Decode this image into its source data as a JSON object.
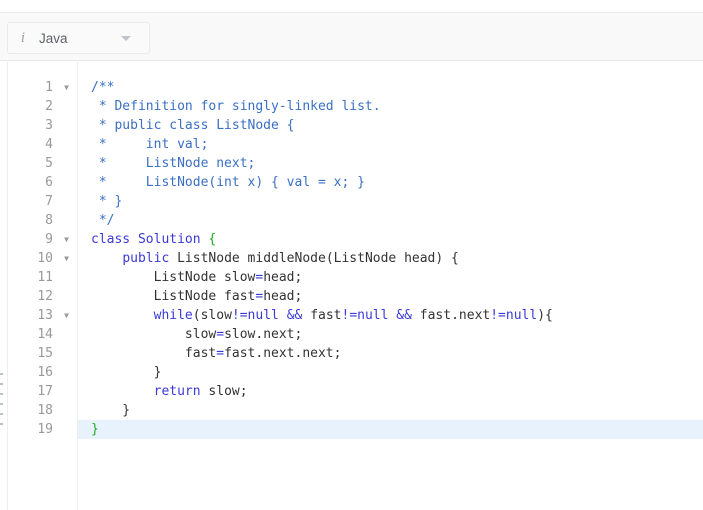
{
  "toolbar": {
    "language_icon": "info-italic-icon",
    "language_label": "Java",
    "language_caret_icon": "caret-down-icon"
  },
  "editor": {
    "active_line": 19,
    "colors": {
      "comment": "#3a6fc4",
      "keyword": "#3a3ad8",
      "brace_match": "#22aa22",
      "active_line_bg": "#e8f2fc"
    },
    "lines": [
      {
        "n": "1",
        "fold": true,
        "tokens": [
          {
            "t": "/**",
            "c": "comment"
          }
        ]
      },
      {
        "n": "2",
        "fold": false,
        "tokens": [
          {
            "t": " * Definition for singly-linked list.",
            "c": "comment"
          }
        ]
      },
      {
        "n": "3",
        "fold": false,
        "tokens": [
          {
            "t": " * public class ListNode {",
            "c": "comment"
          }
        ]
      },
      {
        "n": "4",
        "fold": false,
        "tokens": [
          {
            "t": " *     int val;",
            "c": "comment"
          }
        ]
      },
      {
        "n": "5",
        "fold": false,
        "tokens": [
          {
            "t": " *     ListNode next;",
            "c": "comment"
          }
        ]
      },
      {
        "n": "6",
        "fold": false,
        "tokens": [
          {
            "t": " *     ListNode(int x) { val = x; }",
            "c": "comment"
          }
        ]
      },
      {
        "n": "7",
        "fold": false,
        "tokens": [
          {
            "t": " * }",
            "c": "comment"
          }
        ]
      },
      {
        "n": "8",
        "fold": false,
        "tokens": [
          {
            "t": " */",
            "c": "comment"
          }
        ]
      },
      {
        "n": "9",
        "fold": true,
        "tokens": [
          {
            "t": "class Solution ",
            "c": "kw"
          },
          {
            "t": "{",
            "c": "brace-green"
          }
        ]
      },
      {
        "n": "10",
        "fold": true,
        "tokens": [
          {
            "t": "    ",
            "c": "plain"
          },
          {
            "t": "public",
            "c": "kw"
          },
          {
            "t": " ListNode middleNode(ListNode head) {",
            "c": "plain"
          }
        ]
      },
      {
        "n": "11",
        "fold": false,
        "tokens": [
          {
            "t": "        ListNode slow",
            "c": "plain"
          },
          {
            "t": "=",
            "c": "op"
          },
          {
            "t": "head;",
            "c": "plain"
          }
        ]
      },
      {
        "n": "12",
        "fold": false,
        "tokens": [
          {
            "t": "        ListNode fast",
            "c": "plain"
          },
          {
            "t": "=",
            "c": "op"
          },
          {
            "t": "head;",
            "c": "plain"
          }
        ]
      },
      {
        "n": "13",
        "fold": true,
        "tokens": [
          {
            "t": "        ",
            "c": "plain"
          },
          {
            "t": "while",
            "c": "kw"
          },
          {
            "t": "(slow",
            "c": "plain"
          },
          {
            "t": "!=null",
            "c": "op"
          },
          {
            "t": " && ",
            "c": "op"
          },
          {
            "t": "fast",
            "c": "plain"
          },
          {
            "t": "!=null",
            "c": "op"
          },
          {
            "t": " && ",
            "c": "op"
          },
          {
            "t": "fast.next",
            "c": "plain"
          },
          {
            "t": "!=null",
            "c": "op"
          },
          {
            "t": "){",
            "c": "plain"
          }
        ]
      },
      {
        "n": "14",
        "fold": false,
        "tokens": [
          {
            "t": "            slow",
            "c": "plain"
          },
          {
            "t": "=",
            "c": "op"
          },
          {
            "t": "slow.next;",
            "c": "plain"
          }
        ]
      },
      {
        "n": "15",
        "fold": false,
        "tokens": [
          {
            "t": "            fast",
            "c": "plain"
          },
          {
            "t": "=",
            "c": "op"
          },
          {
            "t": "fast.next.next;",
            "c": "plain"
          }
        ]
      },
      {
        "n": "16",
        "fold": false,
        "tokens": [
          {
            "t": "        }",
            "c": "plain"
          }
        ]
      },
      {
        "n": "17",
        "fold": false,
        "tokens": [
          {
            "t": "        ",
            "c": "plain"
          },
          {
            "t": "return",
            "c": "kw"
          },
          {
            "t": " slow;",
            "c": "plain"
          }
        ]
      },
      {
        "n": "18",
        "fold": false,
        "tokens": [
          {
            "t": "    }",
            "c": "plain"
          }
        ]
      },
      {
        "n": "19",
        "fold": false,
        "tokens": [
          {
            "t": "}",
            "c": "brace-green"
          }
        ]
      }
    ]
  }
}
